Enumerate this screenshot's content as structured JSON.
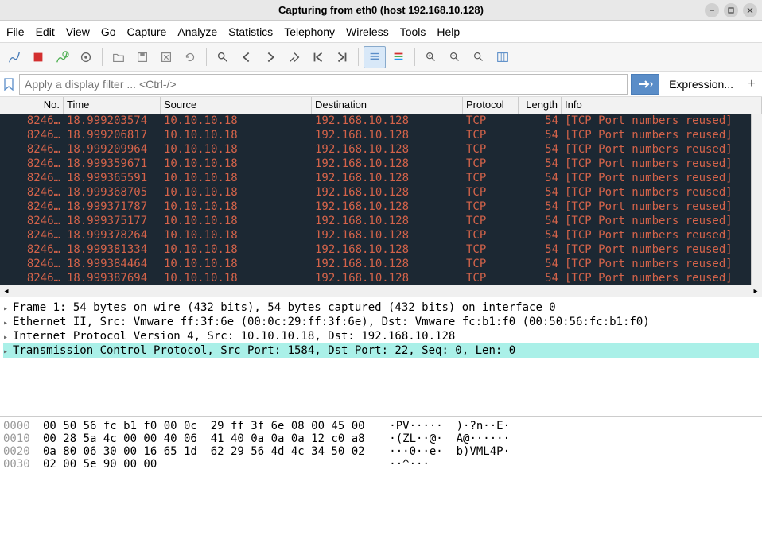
{
  "window": {
    "title": "Capturing from eth0 (host 192.168.10.128)"
  },
  "menus": {
    "file": "File",
    "edit": "Edit",
    "view": "View",
    "go": "Go",
    "capture": "Capture",
    "analyze": "Analyze",
    "statistics": "Statistics",
    "telephony": "Telephony",
    "wireless": "Wireless",
    "tools": "Tools",
    "help": "Help"
  },
  "filter": {
    "placeholder": "Apply a display filter ... <Ctrl-/>",
    "expression": "Expression...",
    "plus": "+"
  },
  "columns": {
    "no": "No.",
    "time": "Time",
    "source": "Source",
    "destination": "Destination",
    "protocol": "Protocol",
    "length": "Length",
    "info": "Info"
  },
  "packets": [
    {
      "no": "8246…",
      "time": "18.999203574",
      "src": "10.10.10.18",
      "dst": "192.168.10.128",
      "proto": "TCP",
      "len": "54",
      "info": "[TCP Port numbers reused]"
    },
    {
      "no": "8246…",
      "time": "18.999206817",
      "src": "10.10.10.18",
      "dst": "192.168.10.128",
      "proto": "TCP",
      "len": "54",
      "info": "[TCP Port numbers reused]"
    },
    {
      "no": "8246…",
      "time": "18.999209964",
      "src": "10.10.10.18",
      "dst": "192.168.10.128",
      "proto": "TCP",
      "len": "54",
      "info": "[TCP Port numbers reused]"
    },
    {
      "no": "8246…",
      "time": "18.999359671",
      "src": "10.10.10.18",
      "dst": "192.168.10.128",
      "proto": "TCP",
      "len": "54",
      "info": "[TCP Port numbers reused]"
    },
    {
      "no": "8246…",
      "time": "18.999365591",
      "src": "10.10.10.18",
      "dst": "192.168.10.128",
      "proto": "TCP",
      "len": "54",
      "info": "[TCP Port numbers reused]"
    },
    {
      "no": "8246…",
      "time": "18.999368705",
      "src": "10.10.10.18",
      "dst": "192.168.10.128",
      "proto": "TCP",
      "len": "54",
      "info": "[TCP Port numbers reused]"
    },
    {
      "no": "8246…",
      "time": "18.999371787",
      "src": "10.10.10.18",
      "dst": "192.168.10.128",
      "proto": "TCP",
      "len": "54",
      "info": "[TCP Port numbers reused]"
    },
    {
      "no": "8246…",
      "time": "18.999375177",
      "src": "10.10.10.18",
      "dst": "192.168.10.128",
      "proto": "TCP",
      "len": "54",
      "info": "[TCP Port numbers reused]"
    },
    {
      "no": "8246…",
      "time": "18.999378264",
      "src": "10.10.10.18",
      "dst": "192.168.10.128",
      "proto": "TCP",
      "len": "54",
      "info": "[TCP Port numbers reused]"
    },
    {
      "no": "8246…",
      "time": "18.999381334",
      "src": "10.10.10.18",
      "dst": "192.168.10.128",
      "proto": "TCP",
      "len": "54",
      "info": "[TCP Port numbers reused]"
    },
    {
      "no": "8246…",
      "time": "18.999384464",
      "src": "10.10.10.18",
      "dst": "192.168.10.128",
      "proto": "TCP",
      "len": "54",
      "info": "[TCP Port numbers reused]"
    },
    {
      "no": "8246…",
      "time": "18.999387694",
      "src": "10.10.10.18",
      "dst": "192.168.10.128",
      "proto": "TCP",
      "len": "54",
      "info": "[TCP Port numbers reused]"
    }
  ],
  "tree": [
    "Frame 1: 54 bytes on wire (432 bits), 54 bytes captured (432 bits) on interface 0",
    "Ethernet II, Src: Vmware_ff:3f:6e (00:0c:29:ff:3f:6e), Dst: Vmware_fc:b1:f0 (00:50:56:fc:b1:f0)",
    "Internet Protocol Version 4, Src: 10.10.10.18, Dst: 192.168.10.128",
    "Transmission Control Protocol, Src Port: 1584, Dst Port: 22, Seq: 0, Len: 0"
  ],
  "hex": [
    {
      "off": "0000",
      "b": "00 50 56 fc b1 f0 00 0c  29 ff 3f 6e 08 00 45 00",
      "a": "·PV·····  )·?n··E·"
    },
    {
      "off": "0010",
      "b": "00 28 5a 4c 00 00 40 06  41 40 0a 0a 0a 12 c0 a8",
      "a": "·(ZL··@·  A@······"
    },
    {
      "off": "0020",
      "b": "0a 80 06 30 00 16 65 1d  62 29 56 4d 4c 34 50 02",
      "a": "···0··e·  b)VML4P·"
    },
    {
      "off": "0030",
      "b": "02 00 5e 90 00 00",
      "a": "··^···"
    }
  ]
}
